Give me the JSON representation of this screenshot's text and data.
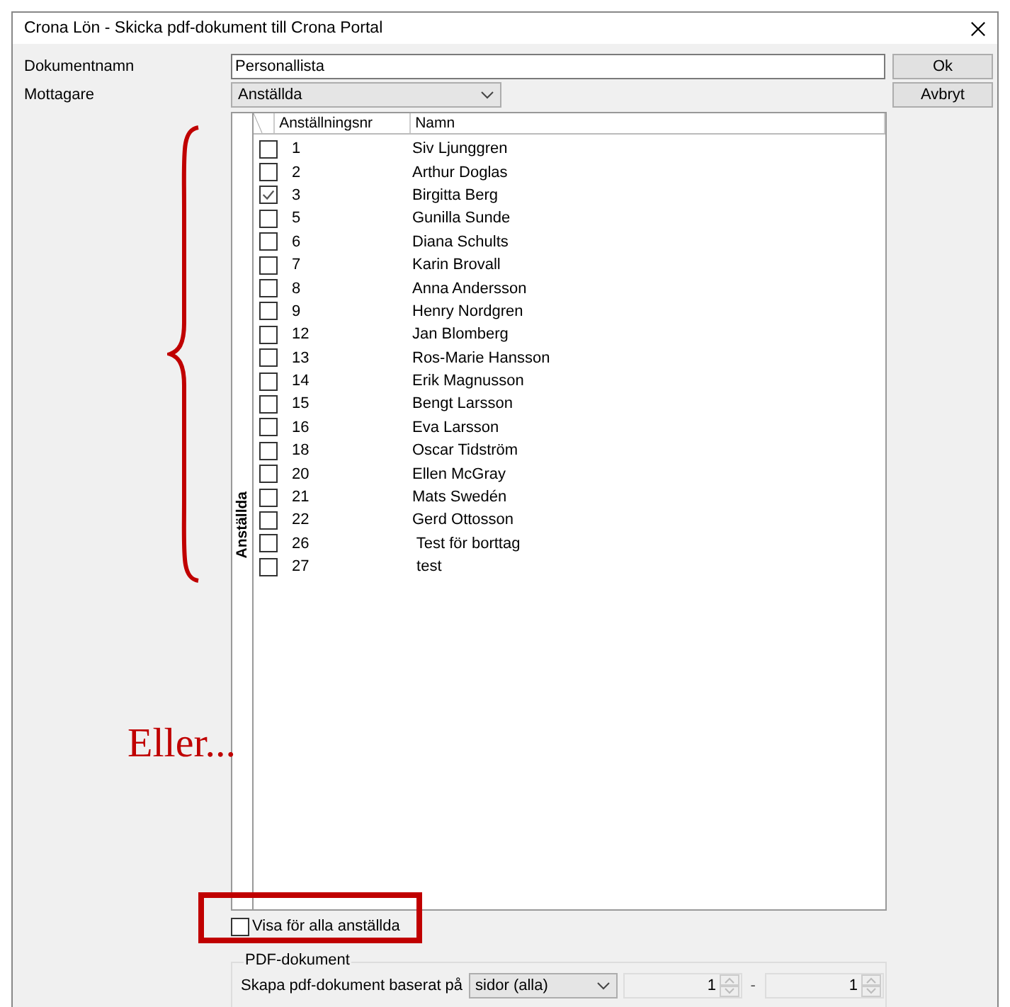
{
  "window": {
    "title": "Crona Lön - Skicka pdf-dokument till Crona Portal"
  },
  "fields": [
    {
      "label": "Dokumentnamn",
      "kind": "text",
      "value": "Personallista"
    },
    {
      "label": "Mottagare",
      "kind": "select",
      "value": "Anställda"
    }
  ],
  "buttons": [
    "Ok",
    "Avbryt"
  ],
  "grid": {
    "group_label": "Anställda",
    "columns": [
      "Anställningsnr",
      "Namn"
    ],
    "rows": [
      {
        "nr": "1",
        "name": "Siv Ljunggren",
        "checked": false
      },
      {
        "nr": "2",
        "name": "Arthur Doglas",
        "checked": false
      },
      {
        "nr": "3",
        "name": "Birgitta Berg",
        "checked": true
      },
      {
        "nr": "5",
        "name": "Gunilla Sunde",
        "checked": false
      },
      {
        "nr": "6",
        "name": "Diana Schults",
        "checked": false
      },
      {
        "nr": "7",
        "name": "Karin Brovall",
        "checked": false
      },
      {
        "nr": "8",
        "name": "Anna Andersson",
        "checked": false
      },
      {
        "nr": "9",
        "name": "Henry Nordgren",
        "checked": false
      },
      {
        "nr": "12",
        "name": "Jan Blomberg",
        "checked": false
      },
      {
        "nr": "13",
        "name": "Ros-Marie Hansson",
        "checked": false
      },
      {
        "nr": "14",
        "name": "Erik Magnusson",
        "checked": false
      },
      {
        "nr": "15",
        "name": "Bengt Larsson",
        "checked": false
      },
      {
        "nr": "16",
        "name": "Eva Larsson",
        "checked": false
      },
      {
        "nr": "18",
        "name": "Oscar Tidström",
        "checked": false
      },
      {
        "nr": "20",
        "name": "Ellen McGray",
        "checked": false
      },
      {
        "nr": "21",
        "name": "Mats Swedén",
        "checked": false
      },
      {
        "nr": "22",
        "name": "Gerd Ottosson",
        "checked": false
      },
      {
        "nr": "26",
        "name": " Test för borttag",
        "checked": false
      },
      {
        "nr": "27",
        "name": " test",
        "checked": false
      }
    ]
  },
  "show_all": {
    "label": "Visa för alla anställda",
    "checked": false
  },
  "pdf": {
    "title": "PDF-dokument",
    "label": "Skapa pdf-dokument baserat på",
    "basis": "sidor (alla)",
    "from": "1",
    "separator": "-",
    "to": "1"
  },
  "annotation": {
    "text": "Eller..."
  }
}
